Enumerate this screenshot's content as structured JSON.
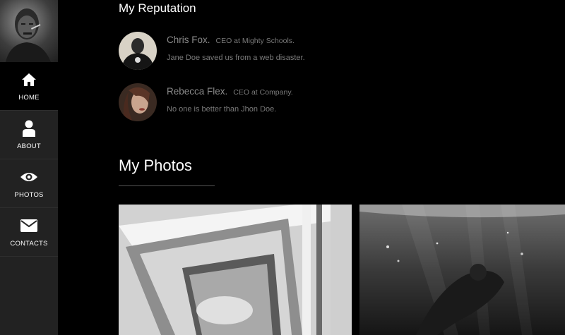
{
  "sidebar": {
    "items": [
      {
        "label": "HOME",
        "icon": "home-icon",
        "active": true
      },
      {
        "label": "ABOUT",
        "icon": "user-icon",
        "active": false
      },
      {
        "label": "PHOTOS",
        "icon": "eye-icon",
        "active": false
      },
      {
        "label": "CONTACTS",
        "icon": "envelope-icon",
        "active": false
      }
    ]
  },
  "reputation": {
    "title": "My Reputation",
    "testimonials": [
      {
        "name": "Chris Fox.",
        "role": "CEO at Mighty Schools.",
        "quote": "Jane Doe saved us from a web disaster."
      },
      {
        "name": "Rebecca Flex.",
        "role": "CEO at Company.",
        "quote": "No one is better than Jhon Doe."
      }
    ]
  },
  "photos": {
    "title": "My Photos"
  },
  "colors": {
    "sidebar_bg": "#222222",
    "active_bg": "#000000",
    "page_bg": "#000000",
    "muted_text": "#8a8a8a"
  }
}
